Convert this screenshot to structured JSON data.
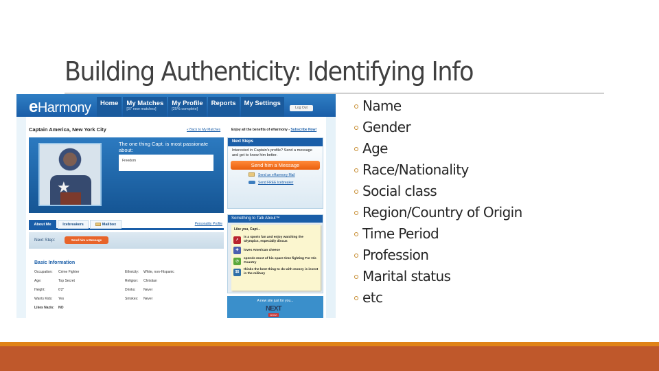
{
  "slide": {
    "title": "Building Authenticity: Identifying Info",
    "bullets": [
      "Name",
      "Gender",
      "Age",
      "Race/Nationality",
      "Social class",
      "Region/Country of Origin",
      "Time Period",
      "Profession",
      "Marital status",
      "etc"
    ],
    "colors": {
      "footer_orange": "#e08317",
      "footer_rust": "#bf582b",
      "title_text": "#404040"
    }
  },
  "eharmony": {
    "logo_e": "e",
    "logo_rest": "Harmony",
    "nav": [
      {
        "label": "Home",
        "sub": ""
      },
      {
        "label": "My Matches",
        "sub": "[37 new matches]"
      },
      {
        "label": "My Profile",
        "sub": "[25% complete]"
      },
      {
        "label": "Reports",
        "sub": ""
      },
      {
        "label": "My Settings",
        "sub": ""
      }
    ],
    "logout": "Log Out",
    "profile_name": "Captain America, New York City",
    "back_link": "« Back to My Matches",
    "enjoy_text": "Enjoy all the benefits of eHarmony - ",
    "subscribe_link": "Subscribe Now!",
    "passion_question": "The one thing Capt. is most passionate about:",
    "passion_answer": "Freedom",
    "next_steps": {
      "header": "Next Steps",
      "text": "Interested in Captain's profile? Send a message and get to know him better.",
      "send_button": "Send him a Message",
      "link_mail": "Send an eHarmony Mail",
      "link_icebreaker": "Send FREE Icebreaker"
    },
    "tabs": [
      "About Me",
      "Icebreakers",
      "Mailbox"
    ],
    "personality_link": "Personality Profile",
    "next_step_label": "Next Step:",
    "next_step_button": "Send him a Message",
    "basic_info": {
      "title": "Basic Information",
      "left": [
        {
          "k": "Occupation:",
          "v": "Crime Fighter"
        },
        {
          "k": "Age:",
          "v": "Top Secret"
        },
        {
          "k": "Height:",
          "v": "6'2\""
        },
        {
          "k": "Wants Kids:",
          "v": "Yes"
        },
        {
          "k": "Likes Nazis:",
          "v": "NO"
        }
      ],
      "right": [
        {
          "k": "Ethnicity:",
          "v": "White, non-Hispanic"
        },
        {
          "k": "Religion:",
          "v": "Christian"
        },
        {
          "k": "Drinks:",
          "v": "Never"
        },
        {
          "k": "Smokes:",
          "v": "Never"
        }
      ]
    },
    "talk": {
      "header": "Something to Talk About™",
      "intro": "Like you, Capt...",
      "items": [
        {
          "icon": "sports-icon",
          "color": "#b8232e",
          "glyph": "➚",
          "text": "is a sports fan and enjoy watching the Olympics, especially discus"
        },
        {
          "icon": "food-icon",
          "color": "#4a5fb0",
          "glyph": "✚",
          "text": "loves American cheese"
        },
        {
          "icon": "clock-icon",
          "color": "#5aa83a",
          "glyph": "◷",
          "text": "spends most of his spare time fighting For His Country"
        },
        {
          "icon": "money-icon",
          "color": "#2f6fa8",
          "glyph": "$$",
          "text": "thinks the best thing to do with money is invest in the military"
        }
      ]
    },
    "new_site": {
      "text": "A new site just for you...",
      "logo": "NEXT",
      "badge": "NOW!"
    }
  }
}
